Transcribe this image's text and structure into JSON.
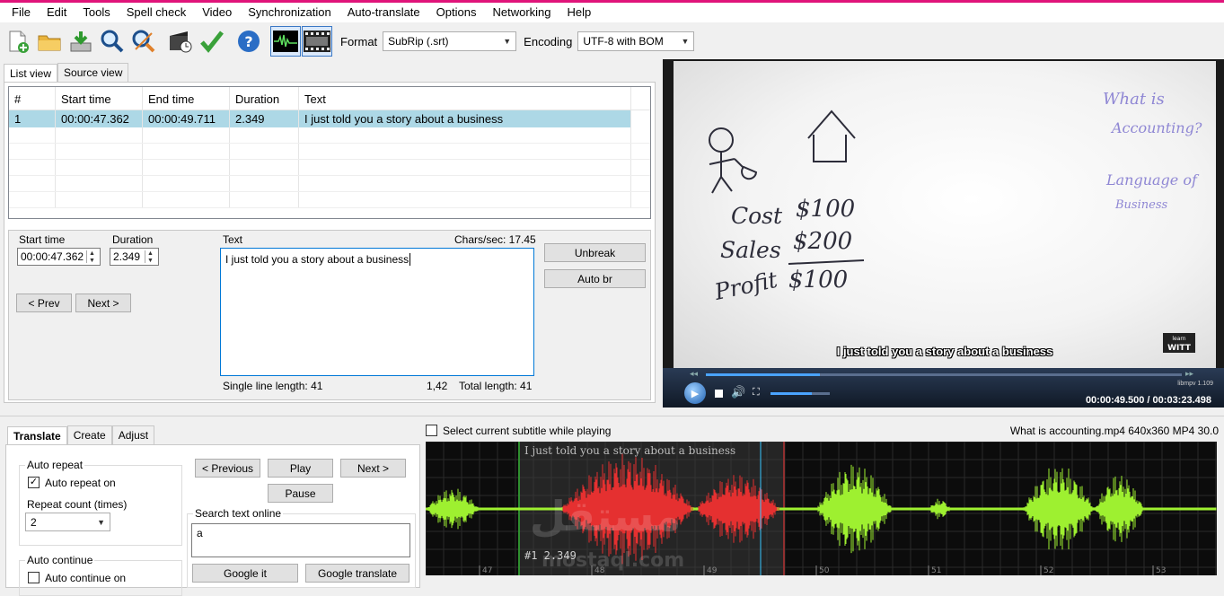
{
  "menu": [
    "File",
    "Edit",
    "Tools",
    "Spell check",
    "Video",
    "Synchronization",
    "Auto-translate",
    "Options",
    "Networking",
    "Help"
  ],
  "toolbar": {
    "icons": [
      "new-file-icon",
      "open-folder-icon",
      "save-icon",
      "find-icon",
      "replace-icon",
      "visual-sync-icon",
      "spell-check-icon",
      "help-icon",
      "waveform-toggle-icon",
      "video-toggle-icon"
    ],
    "format_label": "Format",
    "format_value": "SubRip (.srt)",
    "encoding_label": "Encoding",
    "encoding_value": "UTF-8 with BOM"
  },
  "top_tabs": [
    "List view",
    "Source view"
  ],
  "grid": {
    "headers": [
      "#",
      "Start time",
      "End time",
      "Duration",
      "Text"
    ],
    "rows": [
      [
        "1",
        "00:00:47.362",
        "00:00:49.711",
        "2.349",
        "I just told you a story about  a business"
      ]
    ]
  },
  "editor": {
    "start_time_label": "Start time",
    "start_time_value": "00:00:47.362",
    "duration_label": "Duration",
    "duration_value": "2.349",
    "text_label": "Text",
    "chars_sec": "Chars/sec: 17.45",
    "text_value": "I just told you a story about  a business",
    "prev": "< Prev",
    "next": "Next >",
    "unbreak": "Unbreak",
    "auto_br": "Auto br",
    "single_line": "Single line length: 41",
    "position": "1,42",
    "total_length": "Total length: 41"
  },
  "video": {
    "subtitle": "I just told you a story about  a business",
    "board": {
      "title_line1": "What is",
      "title_line2": "Accounting?",
      "lang_line1": "Language of",
      "lang_line2": "Business",
      "cost": "Cost",
      "cost_val": "$100",
      "sales": "Sales",
      "sales_val": "$200",
      "profit": "Profit",
      "profit_val": "$100",
      "logo_line1": "learn",
      "logo_line2": "WITT"
    },
    "libmpv": "libmpv 1.109",
    "time": "00:00:49.500 / 00:03:23.498",
    "seek_progress": 0.24,
    "volume_level": 0.7
  },
  "bottom": {
    "tabs": [
      "Translate",
      "Create",
      "Adjust"
    ],
    "auto_repeat_legend": "Auto repeat",
    "auto_repeat_on": "Auto repeat on",
    "repeat_count_label": "Repeat count (times)",
    "repeat_count_value": "2",
    "auto_continue_legend": "Auto continue",
    "auto_continue_on": "Auto continue on",
    "previous": "< Previous",
    "play": "Play",
    "next": "Next >",
    "pause": "Pause",
    "search_legend": "Search text online",
    "search_value": "a",
    "google_it": "Google it",
    "google_translate": "Google translate",
    "select_current": "Select current subtitle while playing",
    "media_info": "What is accounting.mp4 640x360 MP4 30.0"
  },
  "waveform": {
    "subtitle": "I just told you a story about  a business",
    "marker": "#1  2.349",
    "ticks": [
      "47",
      "48",
      "49",
      "50",
      "51",
      "52",
      "53"
    ]
  },
  "watermark": {
    "arabic": "مستقل",
    "latin": "mostaql.com"
  },
  "colors": {
    "selection": "#add8e6",
    "wave_selected": "#e53030",
    "wave_normal": "#9ef030",
    "accent_line": "#e0147a"
  }
}
